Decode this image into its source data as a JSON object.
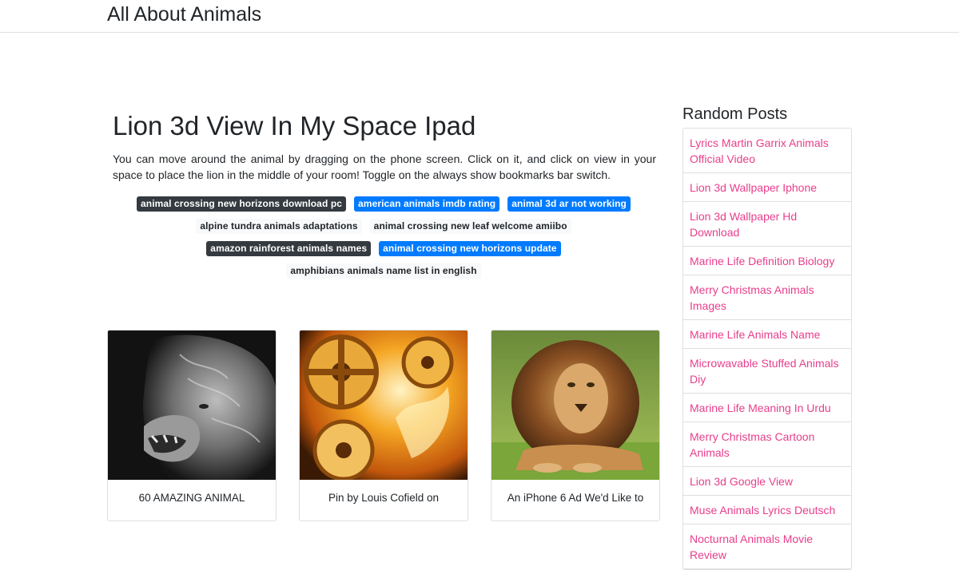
{
  "site": {
    "title": "All About Animals"
  },
  "post": {
    "title": "Lion 3d View In My Space Ipad",
    "description": "You can move around the animal by dragging on the phone screen. Click on it, and click on view in your space to place the lion in the middle of your room! Toggle on the always show bookmarks bar switch."
  },
  "tags": {
    "row1": [
      "animal crossing new horizons download pc",
      "american animals imdb rating",
      "animal 3d ar not working"
    ],
    "row2": [
      "alpine tundra animals adaptations",
      "animal crossing new leaf welcome amiibo"
    ],
    "row3": [
      "amazon rainforest animals names",
      "animal crossing new horizons update"
    ],
    "row4": [
      "amphibians animals name list in english"
    ]
  },
  "cards": [
    {
      "caption": "60 AMAZING ANIMAL"
    },
    {
      "caption": "Pin by Louis Cofield on"
    },
    {
      "caption": "An iPhone 6 Ad We'd Like to"
    }
  ],
  "sidebar": {
    "heading": "Random Posts",
    "items": [
      "Lyrics Martin Garrix Animals Official Video",
      "Lion 3d Wallpaper Iphone",
      "Lion 3d Wallpaper Hd Download",
      "Marine Life Definition Biology",
      "Merry Christmas Animals Images",
      "Marine Life Animals Name",
      "Microwavable Stuffed Animals Diy",
      "Marine Life Meaning In Urdu",
      "Merry Christmas Cartoon Animals",
      "Lion 3d Google View",
      "Muse Animals Lyrics Deutsch",
      "Nocturnal Animals Movie Review"
    ]
  },
  "colors": {
    "link_pink": "#e83e8c",
    "tag_dark": "#343a40",
    "tag_blue": "#007bff",
    "tag_light": "#f8f9fa"
  }
}
